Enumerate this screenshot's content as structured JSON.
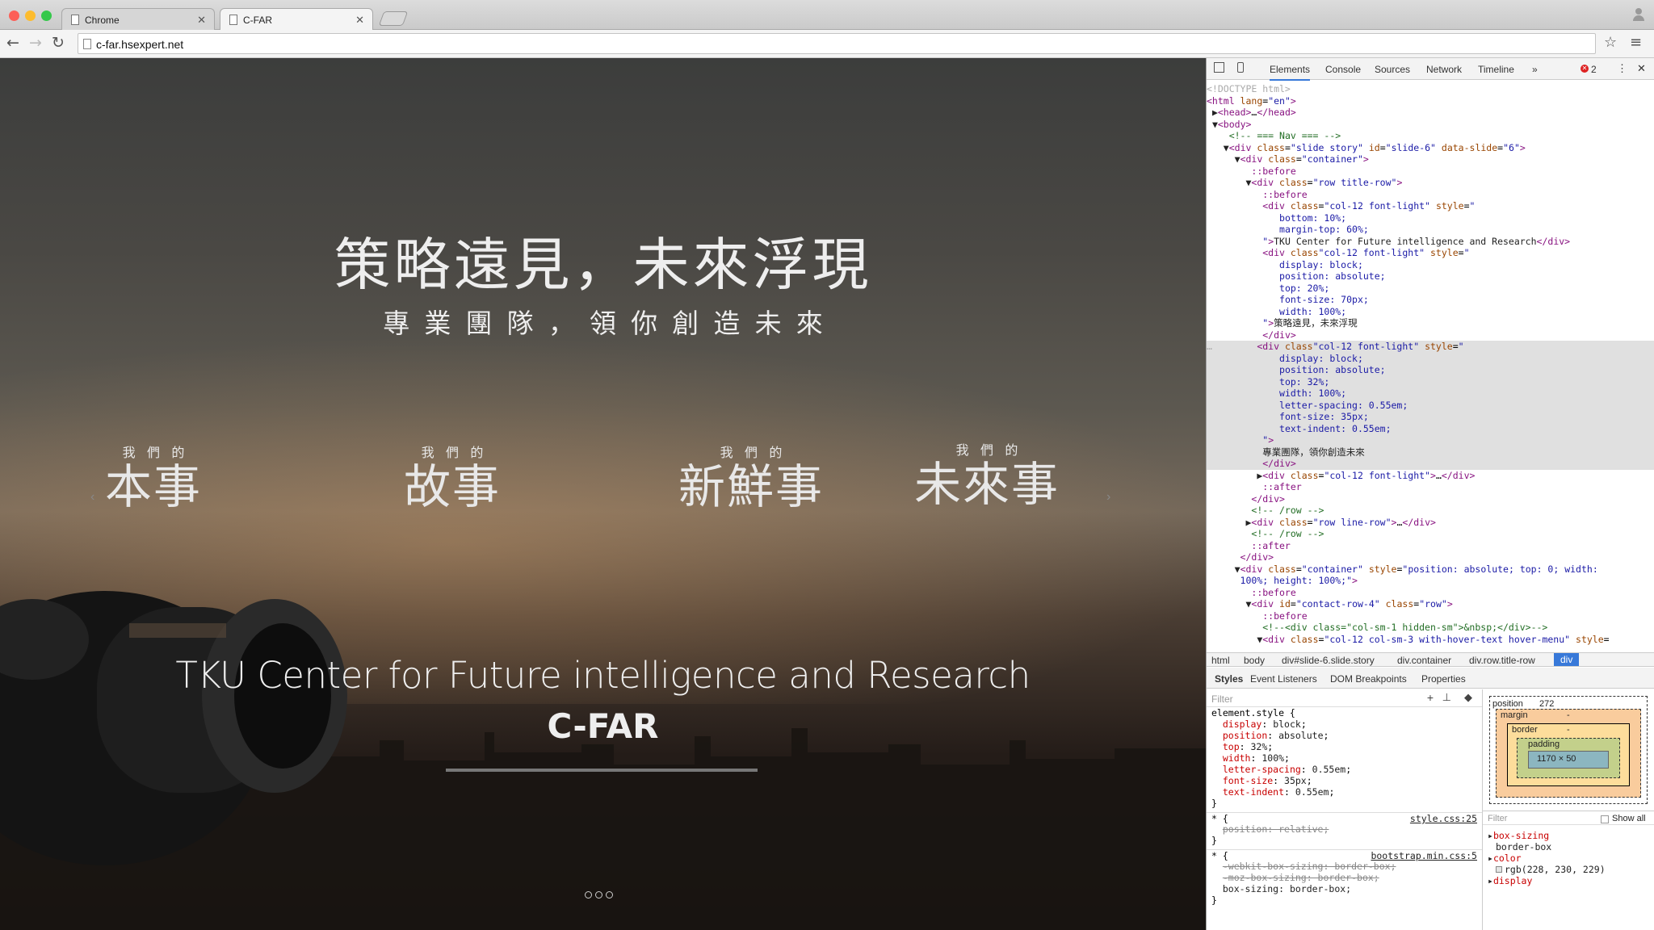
{
  "browser": {
    "tabs": [
      {
        "label": "Chrome"
      },
      {
        "label": "C-FAR"
      }
    ],
    "url": "c-far.hsexpert.net"
  },
  "hero": {
    "headline": "策略遠見，未來浮現",
    "subline": "專業團隊，領你創造未來",
    "services": [
      {
        "small": "我們的",
        "big": "本事"
      },
      {
        "small": "我們的",
        "big": "故事"
      },
      {
        "small": "我們的",
        "big": "新鮮事"
      },
      {
        "small": "我們的",
        "big": "未來事"
      }
    ],
    "org_name": "TKU Center for Future intelligence and Research",
    "org_abbr": "C-FAR"
  },
  "devtools": {
    "tabs": [
      "Elements",
      "Console",
      "Sources",
      "Network",
      "Timeline",
      "»"
    ],
    "error_count": "2",
    "breadcrumbs": [
      "html",
      "body",
      "div#slide-6.slide.story",
      "div.container",
      "div.row.title-row",
      "div"
    ],
    "subtabs": [
      "Styles",
      "Event Listeners",
      "DOM Breakpoints",
      "Properties"
    ],
    "filter_placeholder": "Filter",
    "element_style": [
      {
        "p": "display",
        "v": "block"
      },
      {
        "p": "position",
        "v": "absolute"
      },
      {
        "p": "top",
        "v": "32%"
      },
      {
        "p": "width",
        "v": "100%"
      },
      {
        "p": "letter-spacing",
        "v": "0.55em"
      },
      {
        "p": "font-size",
        "v": "35px"
      },
      {
        "p": "text-indent",
        "v": "0.55em"
      }
    ],
    "rule2_source": "style.css:25",
    "rule2_prop": "position: relative;",
    "rule3_source": "bootstrap.min.css:5",
    "rule3_props": [
      "-webkit-box-sizing: border-box;",
      "-moz-box-sizing: border-box;",
      "box-sizing: border-box;"
    ],
    "boxmodel": {
      "position_label": "position",
      "position_value": "272",
      "margin": "margin",
      "border": "border",
      "padding": "padding",
      "content": "1170 × 50",
      "dash": "-"
    },
    "computed": {
      "filter": "Filter",
      "show_all": "Show all",
      "items": [
        {
          "p": "box-sizing",
          "v": "border-box"
        },
        {
          "p": "color",
          "v": "rgb(228, 230, 229)"
        },
        {
          "p": "display",
          "v": ""
        }
      ]
    }
  }
}
